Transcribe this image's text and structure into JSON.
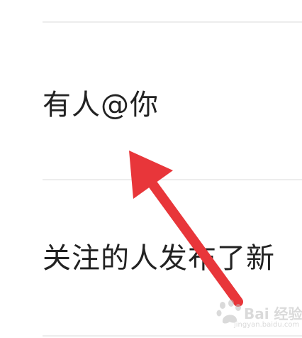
{
  "settings": {
    "rows": [
      {
        "label": "有人@你"
      },
      {
        "label": "关注的人发布了新"
      }
    ]
  },
  "colors": {
    "text": "#222222",
    "divider": "#ededed",
    "arrow": "#e8363a",
    "watermark": "#bdbdbd"
  },
  "watermark": {
    "brand": "Bai 经验",
    "url": "jingyan.baidu.com"
  }
}
